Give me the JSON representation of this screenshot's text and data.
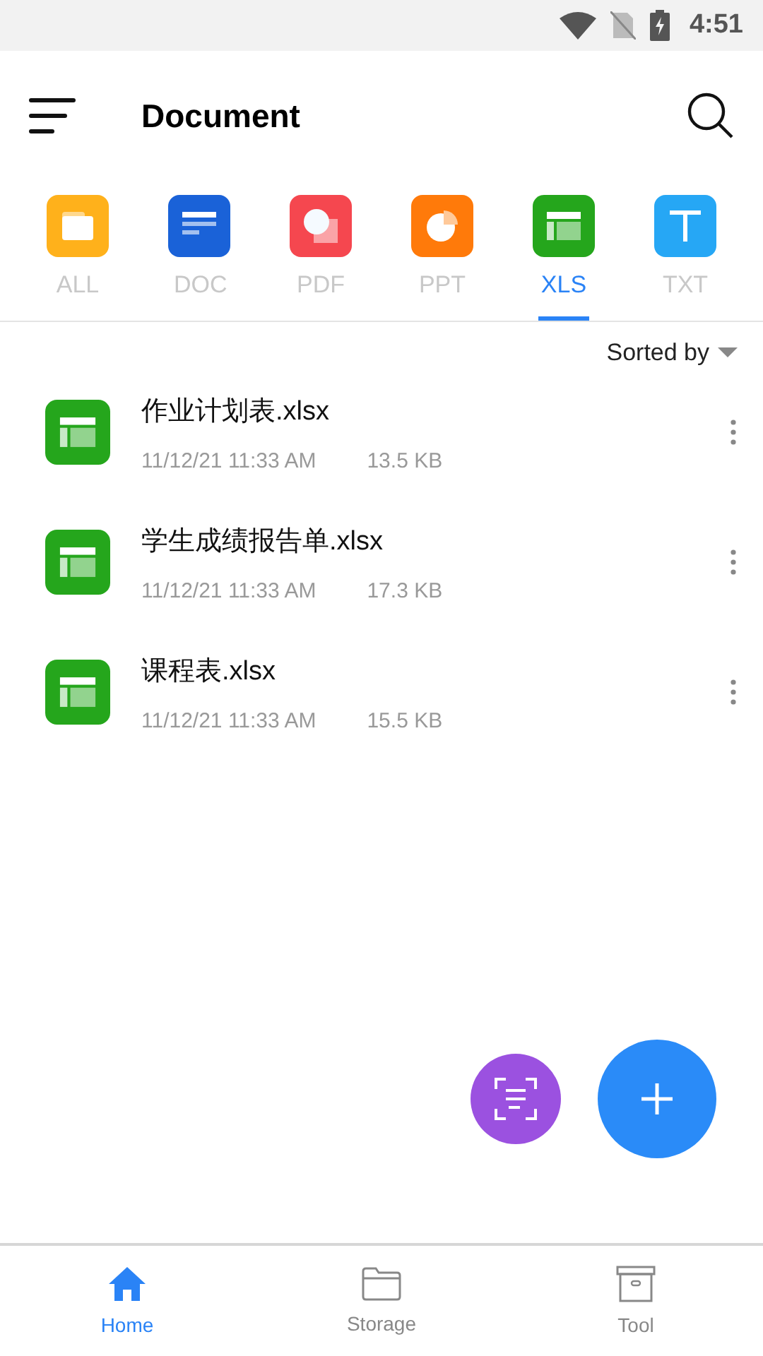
{
  "status_bar": {
    "time": "4:51"
  },
  "header": {
    "title": "Document"
  },
  "categories": [
    {
      "kind": "all",
      "label": "ALL",
      "selected": false
    },
    {
      "kind": "doc",
      "label": "DOC",
      "selected": false
    },
    {
      "kind": "pdf",
      "label": "PDF",
      "selected": false
    },
    {
      "kind": "ppt",
      "label": "PPT",
      "selected": false
    },
    {
      "kind": "xls",
      "label": "XLS",
      "selected": true
    },
    {
      "kind": "txt",
      "label": "TXT",
      "selected": false
    }
  ],
  "sort": {
    "label": "Sorted by"
  },
  "files": [
    {
      "kind": "xls",
      "name": "作业计划表.xlsx",
      "date": "11/12/21 11:33 AM",
      "size": "13.5 KB"
    },
    {
      "kind": "xls",
      "name": "学生成绩报告单.xlsx",
      "date": "11/12/21 11:33 AM",
      "size": "17.3 KB"
    },
    {
      "kind": "xls",
      "name": "课程表.xlsx",
      "date": "11/12/21 11:33 AM",
      "size": "15.5 KB"
    }
  ],
  "bottom_nav": [
    {
      "kind": "home",
      "label": "Home",
      "selected": true
    },
    {
      "kind": "storage",
      "label": "Storage",
      "selected": false
    },
    {
      "kind": "tool",
      "label": "Tool",
      "selected": false
    }
  ]
}
